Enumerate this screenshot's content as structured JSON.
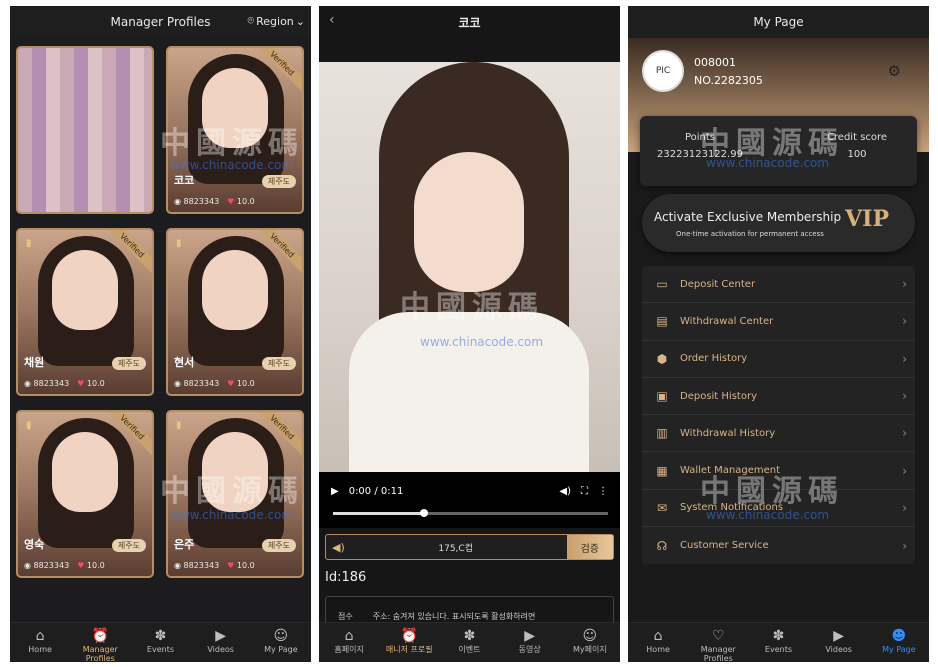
{
  "left": {
    "title": "Manager Profiles",
    "region_label": "Region",
    "cards": [
      {
        "name": "",
        "tag": "",
        "id": "",
        "score": "",
        "blurred": true,
        "verified": false
      },
      {
        "name": "코코",
        "tag": "제주도",
        "id": "8823343",
        "score": "10.0",
        "verified": true
      },
      {
        "name": "채원",
        "tag": "제주도",
        "id": "8823343",
        "score": "10.0",
        "verified": true
      },
      {
        "name": "현서",
        "tag": "제주도",
        "id": "8823343",
        "score": "10.0",
        "verified": true
      },
      {
        "name": "영숙",
        "tag": "제주도",
        "id": "8823343",
        "score": "10.0",
        "verified": true
      },
      {
        "name": "은주",
        "tag": "제주도",
        "id": "8823343",
        "score": "10.0",
        "verified": true
      }
    ],
    "verified_label": "Verified",
    "tabs": [
      {
        "label": "Home",
        "icon": "home-icon"
      },
      {
        "label": "Manager Profiles",
        "icon": "manager-icon"
      },
      {
        "label": "Events",
        "icon": "events-icon"
      },
      {
        "label": "Videos",
        "icon": "videos-icon"
      },
      {
        "label": "My Page",
        "icon": "user-icon"
      }
    ]
  },
  "middle": {
    "title": "코코",
    "time": "0:00 / 0:11",
    "progress_fraction": 0.33,
    "notice_amount": "175,C컵",
    "verify_label": "검증",
    "id_text": "Id:186",
    "info_left": "점수",
    "info_right": "주소: 숨겨져 있습니다. 표시되도록 활성화하려면",
    "tabs": [
      {
        "label": "홈페이지"
      },
      {
        "label": "매니저 프로필"
      },
      {
        "label": "이벤트"
      },
      {
        "label": "동영상"
      },
      {
        "label": "My페이지"
      }
    ]
  },
  "right": {
    "title": "My Page",
    "avatar_text": "PIC",
    "username": "008001",
    "user_no": "NO.2282305",
    "points_label": "Points",
    "points_value": "23223123122.99",
    "credit_label": "Credit score",
    "credit_value": "100",
    "vip_title": "Activate Exclusive Membership",
    "vip_sub": "One-time activation for permanent access",
    "vip_mark": "VIP",
    "menu": [
      {
        "label": "Deposit Center",
        "icon": "wallet-icon"
      },
      {
        "label": "Withdrawal Center",
        "icon": "withdraw-icon"
      },
      {
        "label": "Order History",
        "icon": "order-icon"
      },
      {
        "label": "Deposit History",
        "icon": "deposit-history-icon"
      },
      {
        "label": "Withdrawal History",
        "icon": "withdrawal-history-icon"
      },
      {
        "label": "Wallet Management",
        "icon": "wallet-manage-icon"
      },
      {
        "label": "System Notifications",
        "icon": "mail-icon"
      },
      {
        "label": "Customer Service",
        "icon": "headset-icon"
      }
    ],
    "tabs": [
      {
        "label": "Home"
      },
      {
        "label": "Manager Profiles"
      },
      {
        "label": "Events"
      },
      {
        "label": "Videos"
      },
      {
        "label": "My Page"
      }
    ]
  },
  "watermark": {
    "text": "中國源碼",
    "url": "www.chinacode.com"
  }
}
